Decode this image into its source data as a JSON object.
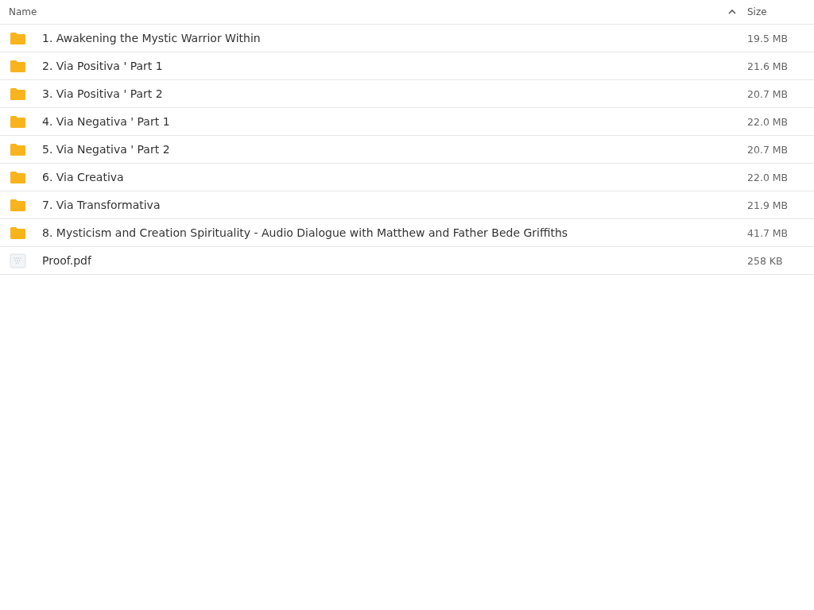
{
  "table": {
    "columns": [
      {
        "label": "Name",
        "sorted": true
      },
      {
        "label": "Size",
        "sorted": false
      }
    ],
    "rows": [
      {
        "kind": "folder",
        "name": "1. Awakening the Mystic Warrior Within",
        "size": "19.5 MB"
      },
      {
        "kind": "folder",
        "name": "2. Via Positiva ' Part 1",
        "size": "21.6 MB"
      },
      {
        "kind": "folder",
        "name": "3. Via Positiva ' Part 2",
        "size": "20.7 MB"
      },
      {
        "kind": "folder",
        "name": "4. Via Negativa ' Part 1",
        "size": "22.0 MB"
      },
      {
        "kind": "folder",
        "name": "5. Via Negativa ' Part 2",
        "size": "20.7 MB"
      },
      {
        "kind": "folder",
        "name": "6. Via Creativa",
        "size": "22.0 MB"
      },
      {
        "kind": "folder",
        "name": "7. Via Transformativa",
        "size": "21.9 MB"
      },
      {
        "kind": "folder",
        "name": "8. Mysticism and Creation Spirituality - Audio Dialogue with Matthew and Father Bede Griffiths",
        "size": "41.7 MB"
      },
      {
        "kind": "file",
        "name": "Proof.pdf",
        "size": "258 KB"
      }
    ]
  }
}
